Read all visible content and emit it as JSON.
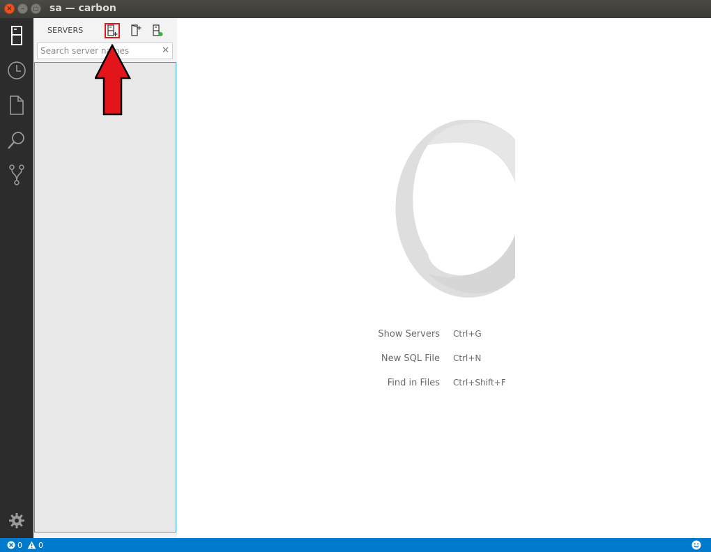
{
  "window": {
    "title": "sa — carbon",
    "controls": {
      "close": "×",
      "minimize": "–",
      "maximize": "□"
    }
  },
  "activity_bar": {
    "items": [
      {
        "name": "servers",
        "icon": "server-icon"
      },
      {
        "name": "history",
        "icon": "clock-icon"
      },
      {
        "name": "explorer",
        "icon": "file-icon"
      },
      {
        "name": "search",
        "icon": "search-icon"
      },
      {
        "name": "source-control",
        "icon": "git-branch-icon"
      }
    ],
    "settings_icon": "gear-icon"
  },
  "sidebar": {
    "title": "SERVERS",
    "actions": [
      {
        "name": "new-connection",
        "icon": "add-server-icon",
        "highlighted": true
      },
      {
        "name": "add-server-group",
        "icon": "add-server-group-icon"
      },
      {
        "name": "active-connections",
        "icon": "active-server-icon"
      }
    ],
    "search": {
      "placeholder": "Search server names",
      "value": "",
      "clear": "✕"
    }
  },
  "welcome": {
    "shortcuts": [
      {
        "label": "Show Servers",
        "key": "Ctrl+G"
      },
      {
        "label": "New SQL File",
        "key": "Ctrl+N"
      },
      {
        "label": "Find in Files",
        "key": "Ctrl+Shift+F"
      }
    ]
  },
  "status_bar": {
    "errors": "0",
    "warnings": "0",
    "feedback_icon": "smiley-icon"
  },
  "colors": {
    "status_bar": "#007acc",
    "activity_bar": "#2c2c2c",
    "annotation_arrow": "#e4141b",
    "connected_dot": "#3bb143"
  }
}
